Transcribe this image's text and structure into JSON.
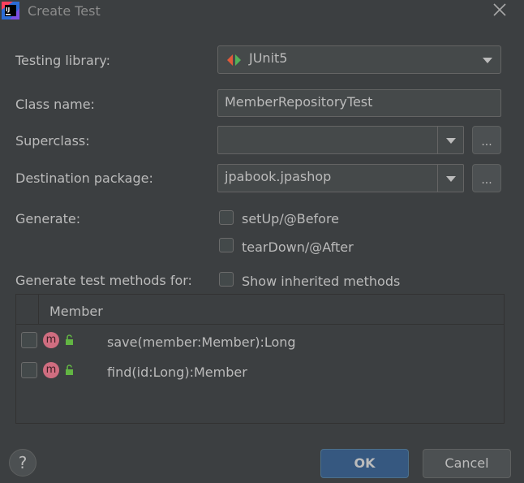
{
  "window": {
    "title": "Create Test",
    "app_icon": "intellij-idea-icon",
    "close_icon": "close-icon"
  },
  "form": {
    "testing_library": {
      "label": "Testing library:",
      "value": "JUnit5",
      "icon": "junit5-icon"
    },
    "class_name": {
      "label": "Class name:",
      "value": "MemberRepositoryTest"
    },
    "superclass": {
      "label": "Superclass:",
      "value": "",
      "browse_label": "..."
    },
    "destination_package": {
      "label": "Destination package:",
      "value": "jpabook.jpashop",
      "browse_label": "..."
    },
    "generate": {
      "label": "Generate:",
      "options": [
        {
          "label": "setUp/@Before",
          "checked": false
        },
        {
          "label": "tearDown/@After",
          "checked": false
        }
      ]
    },
    "methods_for": {
      "label": "Generate test methods for:",
      "show_inherited": {
        "label": "Show inherited methods",
        "checked": false
      }
    }
  },
  "table": {
    "header": "Member",
    "rows": [
      {
        "checked": false,
        "badge": "m",
        "name": "save(member:Member):Long"
      },
      {
        "checked": false,
        "badge": "m",
        "name": "find(id:Long):Member"
      }
    ]
  },
  "footer": {
    "help_label": "?",
    "ok_label": "OK",
    "cancel_label": "Cancel"
  },
  "colors": {
    "background": "#3c3f41",
    "text": "#bbbbbb",
    "field": "#45494a",
    "primary_button": "#365880",
    "method_badge": "#cf6d80",
    "lock_icon": "#62b543"
  }
}
